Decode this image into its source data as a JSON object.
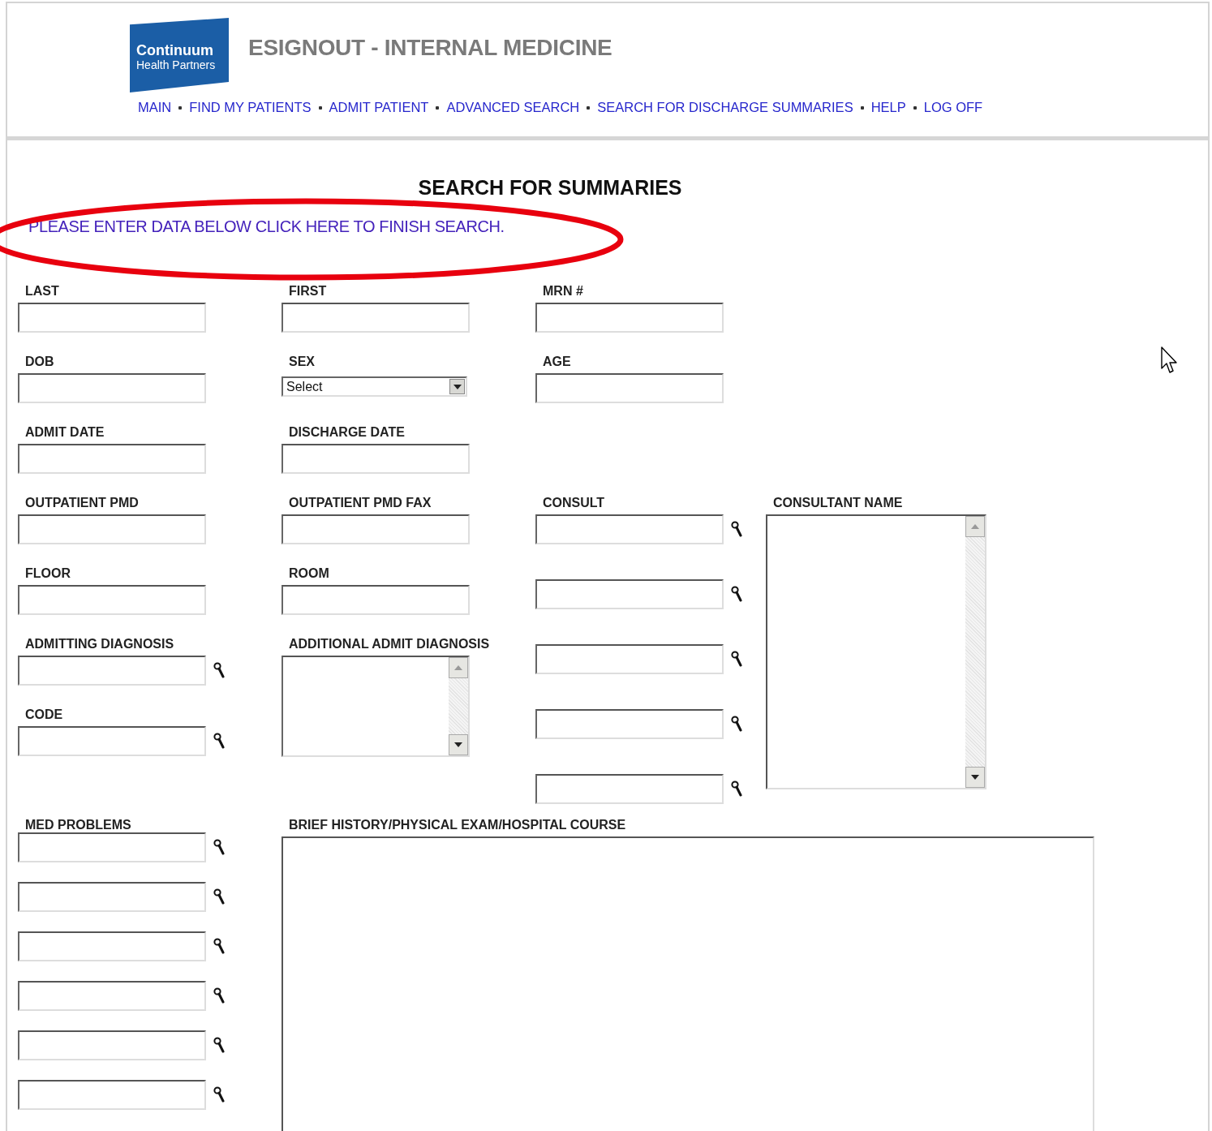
{
  "header": {
    "logo": {
      "name": "Continuum",
      "subtitle": "Health Partners"
    },
    "title": "ESIGNOUT - INTERNAL MEDICINE",
    "nav": [
      {
        "label": "MAIN"
      },
      {
        "label": "FIND MY PATIENTS"
      },
      {
        "label": "ADMIT PATIENT"
      },
      {
        "label": "ADVANCED SEARCH"
      },
      {
        "label": "SEARCH FOR DISCHARGE SUMMARIES"
      },
      {
        "label": "HELP"
      },
      {
        "label": "LOG OFF"
      }
    ]
  },
  "page_title": "SEARCH FOR SUMMARIES",
  "instruction": "PLEASE ENTER DATA BELOW CLICK HERE TO FINISH SEARCH.",
  "form": {
    "columns": [
      {
        "fields": [
          {
            "label": "LAST",
            "kind": "text"
          },
          {
            "label": "DOB",
            "kind": "text"
          },
          {
            "label": "ADMIT DATE",
            "kind": "text"
          },
          {
            "label": "OUTPATIENT PMD",
            "kind": "text"
          },
          {
            "label": "FLOOR",
            "kind": "text"
          },
          {
            "label": "ADMITTING DIAGNOSIS",
            "kind": "lookup"
          },
          {
            "label": "CODE",
            "kind": "lookup"
          }
        ]
      },
      {
        "fields": [
          {
            "label": "FIRST",
            "kind": "text"
          },
          {
            "label": "SEX",
            "kind": "select",
            "value": "Select"
          },
          {
            "label": "DISCHARGE DATE",
            "kind": "text"
          },
          {
            "label": "OUTPATIENT PMD FAX",
            "kind": "text"
          },
          {
            "label": "ROOM",
            "kind": "text"
          },
          {
            "label": "ADDITIONAL ADMIT DIAGNOSIS",
            "kind": "textarea"
          }
        ]
      },
      {
        "fields": [
          {
            "label": "MRN #",
            "kind": "text"
          },
          {
            "label": "AGE",
            "kind": "text"
          },
          {
            "label": "CONSULT",
            "kind": "lookup_list",
            "inputs": [
              {
                "kind": "lookup"
              },
              {
                "kind": "lookup"
              },
              {
                "kind": "lookup"
              },
              {
                "kind": "lookup"
              },
              {
                "kind": "lookup"
              }
            ]
          }
        ]
      },
      {
        "fields": [
          {
            "label": "CONSULTANT NAME",
            "kind": "listbox"
          }
        ]
      }
    ]
  },
  "details": {
    "med_problems": {
      "label": "MED PROBLEMS",
      "inputs": [
        {
          "kind": "lookup"
        },
        {
          "kind": "lookup"
        },
        {
          "kind": "lookup"
        },
        {
          "kind": "lookup"
        },
        {
          "kind": "lookup"
        },
        {
          "kind": "lookup"
        }
      ]
    },
    "history": {
      "label": "BRIEF HISTORY/PHYSICAL EXAM/HOSPITAL COURSE"
    }
  }
}
